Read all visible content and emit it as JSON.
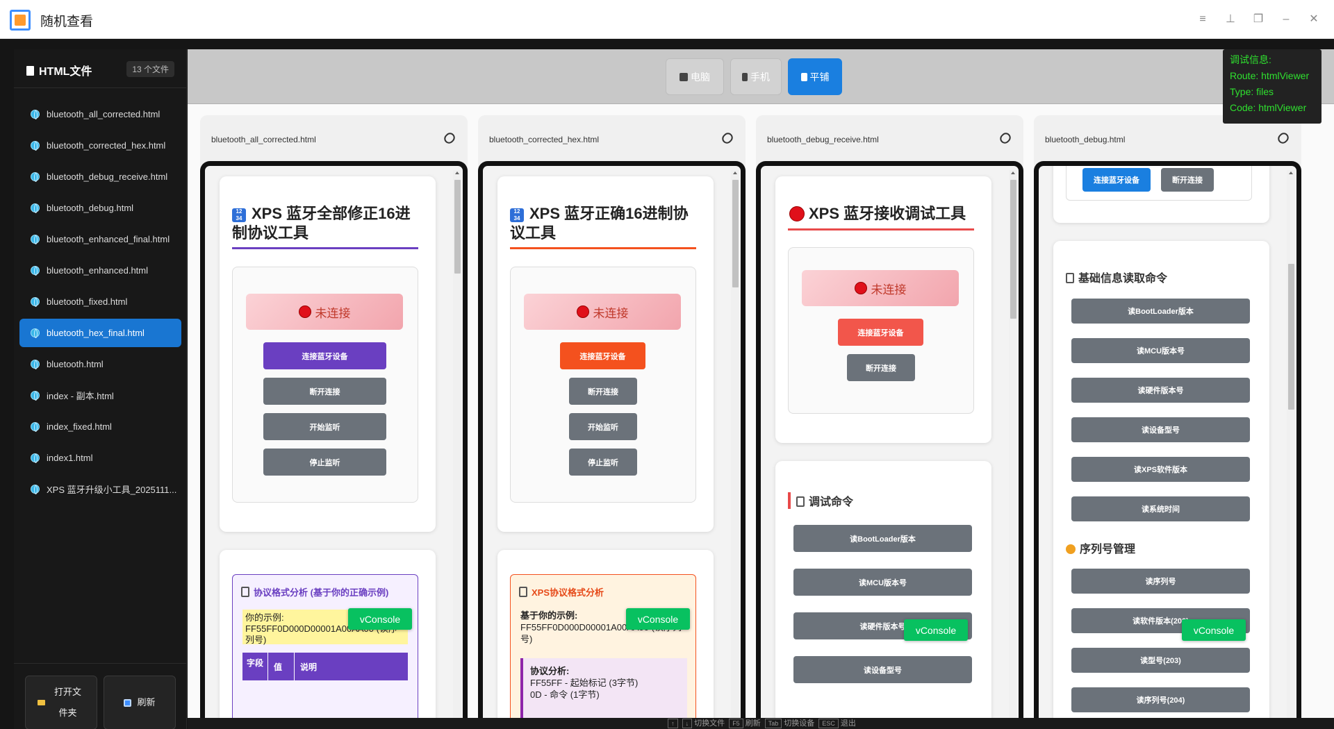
{
  "app": {
    "title": "随机查看"
  },
  "sidebar": {
    "title": "HTML文件",
    "count": "13 个文件",
    "items": [
      {
        "label": "bluetooth_all_corrected.html"
      },
      {
        "label": "bluetooth_corrected_hex.html"
      },
      {
        "label": "bluetooth_debug_receive.html"
      },
      {
        "label": "bluetooth_debug.html"
      },
      {
        "label": "bluetooth_enhanced_final.html"
      },
      {
        "label": "bluetooth_enhanced.html"
      },
      {
        "label": "bluetooth_fixed.html"
      },
      {
        "label": "bluetooth_hex_final.html",
        "active": true
      },
      {
        "label": "bluetooth.html"
      },
      {
        "label": "index - 副本.html"
      },
      {
        "label": "index_fixed.html"
      },
      {
        "label": "index1.html"
      },
      {
        "label": "XPS 蓝牙升级小工具_2025111..."
      }
    ],
    "open_folder": "打开文件夹",
    "refresh": "刷新"
  },
  "toolbar": {
    "desktop": "电脑",
    "mobile": "手机",
    "tile": "平铺"
  },
  "debug": {
    "line1": "调试信息:",
    "line2": "Route: htmlViewer",
    "line3": "Type: files",
    "line4": "Code: htmlViewer"
  },
  "cards": [
    {
      "name": "bluetooth_all_corrected.html",
      "title": "XPS 蓝牙全部修正16进制协议工具",
      "status": "未连接",
      "connect": "连接蓝牙设备",
      "disconnect": "断开连接",
      "start": "开始监听",
      "stop": "停止监听",
      "section": "协议格式分析 (基于你的正确示例)",
      "example_label": "你的示例:",
      "example": "FF55FF0D000D00001A00AA00 (读序列号)",
      "th1": "字段",
      "th2": "值",
      "th3": "说明",
      "accent": "#6a3fc1"
    },
    {
      "name": "bluetooth_corrected_hex.html",
      "title": "XPS 蓝牙正确16进制协议工具",
      "status": "未连接",
      "connect": "连接蓝牙设备",
      "disconnect": "断开连接",
      "start": "开始监听",
      "stop": "停止监听",
      "section": "XPS协议格式分析",
      "example_label": "基于你的示例:",
      "example": "FF55FF0D000D00001A00AA00 (读序列号)",
      "analysis_label": "协议分析:",
      "a1": "FF55FF - 起始标记 (3字节)",
      "a2": "0D - 命令 (1字节)",
      "accent": "#f4511e"
    },
    {
      "name": "bluetooth_debug_receive.html",
      "title": "XPS 蓝牙接收调试工具",
      "status": "未连接",
      "connect": "连接蓝牙设备",
      "disconnect": "断开连接",
      "section": "调试命令",
      "cmds": [
        "读BootLoader版本",
        "读MCU版本号",
        "读硬件版本号",
        "读设备型号"
      ],
      "accent": "#e84a4a"
    },
    {
      "name": "bluetooth_debug.html",
      "connect": "连接蓝牙设备",
      "disconnect": "断开连接",
      "section1": "基础信息读取命令",
      "cmds1": [
        "读BootLoader版本",
        "读MCU版本号",
        "读硬件版本号",
        "读设备型号",
        "读XPS软件版本",
        "读系统时间"
      ],
      "section2": "序列号管理",
      "cmds2": [
        "读序列号",
        "读软件版本(202)",
        "读型号(203)",
        "读序列号(204)"
      ],
      "accent": "#1a7fe0"
    }
  ],
  "vconsole": "vConsole",
  "statusbar": {
    "switch_file": "切换文件",
    "refresh": "刷新",
    "switch_device": "切换设备",
    "exit": "退出",
    "k1": "↑",
    "k2": "↓",
    "k3": "F5",
    "k4": "Tab",
    "k5": "ESC"
  }
}
